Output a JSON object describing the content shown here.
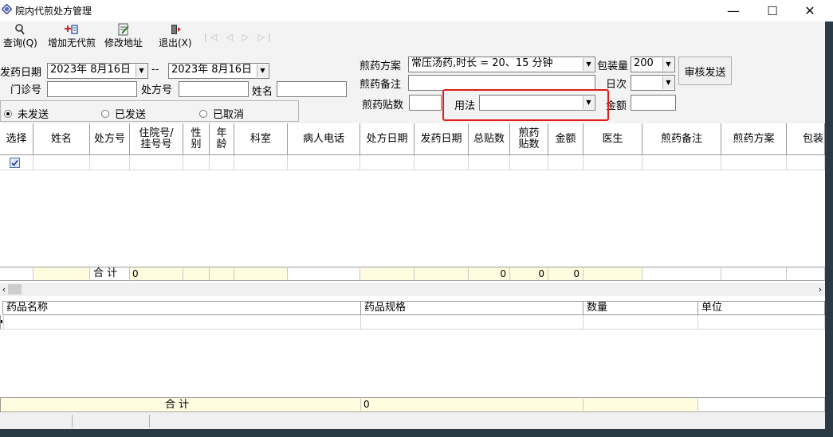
{
  "window": {
    "title": "院内代煎处方管理",
    "controls": {
      "minimize": "—",
      "maximize": "☐",
      "close": "✕"
    }
  },
  "toolbar": {
    "query_label": "查询(Q)",
    "add_label": "增加无代煎",
    "modify_label": "修改地址",
    "exit_label": "退出(X)",
    "nav_glyphs": "|◁ ◁ ▷ ▷|"
  },
  "filters": {
    "dispense_date_label": "发药日期",
    "date_from": "2023年  8月16日",
    "date_sep": "--",
    "date_to": "2023年  8月16日",
    "clinic_no_label": "门诊号",
    "clinic_no_value": "",
    "rx_no_label": "处方号",
    "rx_no_value": "",
    "name_label": "姓名",
    "name_value": "",
    "decoct_plan_label": "煎药方案",
    "decoct_plan_value": "常压汤药,时长 = 20、15 分钟",
    "package_label": "包装量",
    "package_value": "200",
    "decoct_note_label": "煎药备注",
    "decoct_note_value": "",
    "daily_label": "日次",
    "daily_value": "",
    "decoct_doses_label": "煎药贴数",
    "decoct_doses_value": "",
    "usage_label": "用法",
    "usage_value": "",
    "amount_label": "金额",
    "amount_value": "",
    "review_send_label": "审核发送",
    "status_options": [
      "未发送",
      "已发送",
      "已取消"
    ],
    "status_selected": "未发送"
  },
  "grid": {
    "columns": [
      "选择",
      "姓名",
      "处方号",
      "住院号/\n挂号号",
      "性\n别",
      "年\n龄",
      "科室",
      "病人电话",
      "处方日期",
      "发药日期",
      "总贴数",
      "煎药\n贴数",
      "金额",
      "医生",
      "煎药备注",
      "煎药方案",
      "包装"
    ],
    "total_label": "合  计",
    "total_rx": "0",
    "total_doses": "0",
    "total_decoct_doses": "0",
    "total_amount": "0"
  },
  "detail_grid": {
    "columns": [
      "药品名称",
      "药品规格",
      "数量",
      "单位"
    ],
    "total_label": "合  计",
    "total_spec": "0"
  },
  "colors": {
    "highlight_box": "#e31b1b",
    "total_row_bg": "#fffce0",
    "panel_bg": "#f3f3f3"
  }
}
